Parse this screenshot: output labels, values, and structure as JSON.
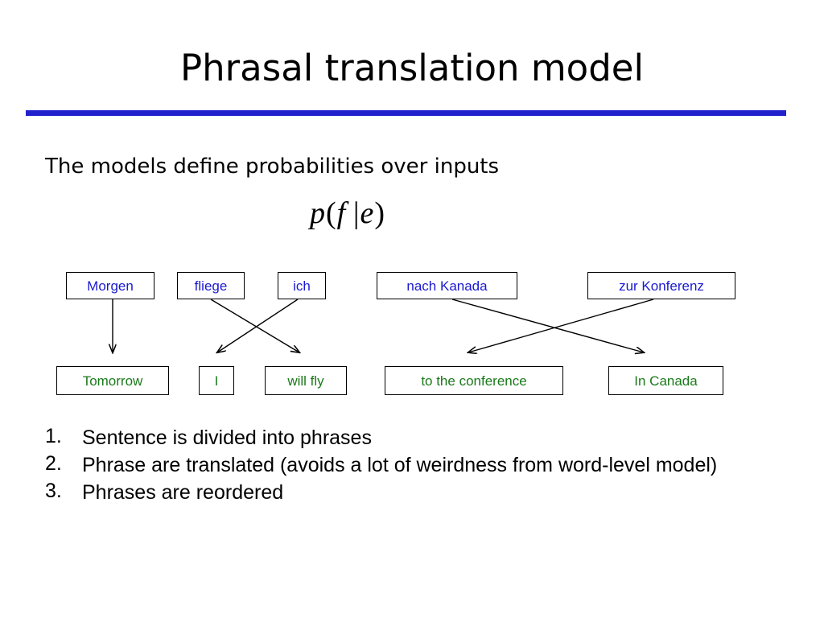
{
  "slide": {
    "title": "Phrasal translation model",
    "lead_text": "The models define probabilities over inputs",
    "formula": {
      "p": "p",
      "open": "(",
      "f": "f",
      "bar": "|",
      "e": "e",
      "close": ")"
    },
    "accent_color": "#2222cc",
    "source_color": "#1a1ad0",
    "target_color": "#1a7a1a"
  },
  "diagram": {
    "source_phrases": [
      {
        "label": "Morgen"
      },
      {
        "label": "fliege"
      },
      {
        "label": "ich"
      },
      {
        "label": "nach Kanada"
      },
      {
        "label": "zur Konferenz"
      }
    ],
    "target_phrases": [
      {
        "label": "Tomorrow"
      },
      {
        "label": "I"
      },
      {
        "label": "will fly"
      },
      {
        "label": "to the conference"
      },
      {
        "label": "In Canada"
      }
    ],
    "alignments": [
      {
        "from": "Morgen",
        "to": "Tomorrow"
      },
      {
        "from": "fliege",
        "to": "will fly"
      },
      {
        "from": "ich",
        "to": "I"
      },
      {
        "from": "nach Kanada",
        "to": "In Canada"
      },
      {
        "from": "zur Konferenz",
        "to": "to the conference"
      }
    ]
  },
  "bullets": [
    {
      "num": "1.",
      "text": "Sentence is divided into phrases"
    },
    {
      "num": "2.",
      "text": "Phrase are translated (avoids a lot of weirdness from word-level model)"
    },
    {
      "num": "3.",
      "text": "Phrases are reordered"
    }
  ]
}
